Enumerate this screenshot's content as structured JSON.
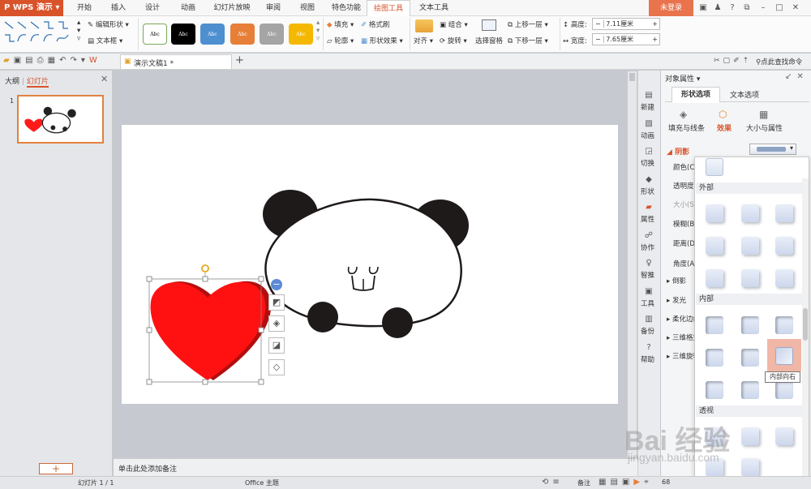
{
  "app": {
    "name": "WPS 演示"
  },
  "menu": {
    "tabs": [
      "开始",
      "插入",
      "设计",
      "动画",
      "幻灯片放映",
      "审阅",
      "视图",
      "特色功能",
      "绘图工具",
      "文本工具"
    ],
    "active_index": 8,
    "login": "未登录"
  },
  "ribbon": {
    "edit_shape": "编辑形状",
    "textbox": "文本框",
    "style_sample": "Abc",
    "style_colors": [
      "#ffffff",
      "#000000",
      "#4e8fd0",
      "#e77f38",
      "#a5a5a5",
      "#f5b800"
    ],
    "fill": "填充",
    "format_brush": "格式刷",
    "outline": "轮廓",
    "shape_effect": "形状效果",
    "align": "对齐",
    "group": "组合",
    "rotate": "旋转",
    "selection_pane": "选择窗格",
    "bring_forward": "上移一层",
    "send_backward": "下移一层",
    "height_label": "高度:",
    "height_value": "7.11厘米",
    "width_label": "宽度:",
    "width_value": "7.65厘米"
  },
  "quick": {
    "doc_tab": "演示文稿1 *",
    "search": "点此查找命令"
  },
  "left": {
    "tab_outline": "大纲",
    "tab_slides": "幻灯片",
    "slide_number": "1",
    "add": "+"
  },
  "notes_placeholder": "单击此处添加备注",
  "sidebar_buttons": [
    "新建",
    "动画",
    "切换",
    "形状",
    "属性",
    "协作",
    "智推",
    "工具",
    "备份",
    "帮助"
  ],
  "properties": {
    "title": "对象属性",
    "tab_shape": "形状选项",
    "tab_text": "文本选项",
    "sub_fill": "填充与线条",
    "sub_effect": "效果",
    "sub_size": "大小与属性",
    "section_shadow": "阴影",
    "rows": [
      "颜色(C)",
      "透明度",
      "大小(S)",
      "模糊(B)",
      "距离(D)",
      "角度(A)"
    ],
    "collapsed": [
      "倒影",
      "发光",
      "柔化边缘",
      "三维格式",
      "三维旋转"
    ]
  },
  "popup": {
    "outer": "外部",
    "inner": "内部",
    "perspective": "透视",
    "tooltip": "内部向右"
  },
  "status": {
    "slide_info": "幻灯片 1 / 1",
    "theme": "Office 主题",
    "notes": "备注",
    "zoom": "68"
  },
  "watermark": {
    "brand": "Bai 经验",
    "url": "jingyan.baidu.com"
  }
}
